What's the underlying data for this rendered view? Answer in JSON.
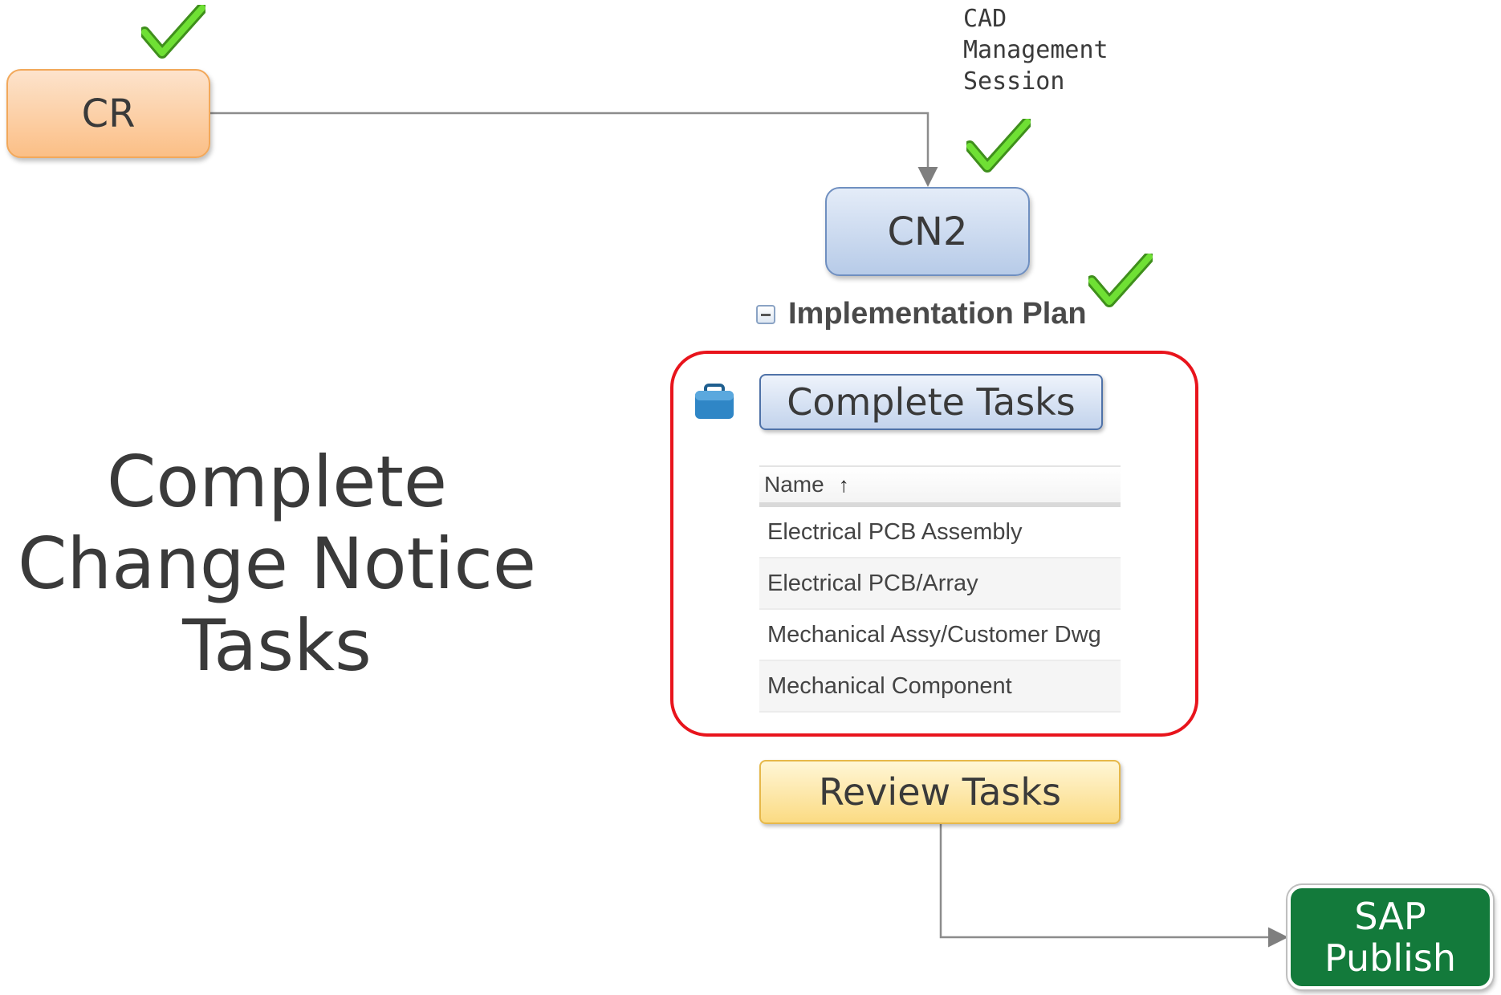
{
  "nodes": {
    "cr": "CR",
    "cn2": "CN2",
    "cad_session": "CAD\nManagement\nSession",
    "implementation_plan": "Implementation Plan",
    "complete_tasks": "Complete Tasks",
    "review_tasks": "Review Tasks",
    "sap_publish": "SAP\nPublish"
  },
  "task_table": {
    "header": "Name",
    "sort_indicator": "↑",
    "rows": [
      "Electrical PCB Assembly",
      "Electrical PCB/Array",
      "Mechanical Assy/Customer Dwg",
      "Mechanical Component"
    ]
  },
  "title": "Complete\nChange Notice\nTasks",
  "icons": [
    "check-icon",
    "check-icon",
    "check-icon",
    "briefcase-icon",
    "collapse-icon"
  ],
  "colors": {
    "cr": "#fbbf86",
    "cn2": "#b7cbe8",
    "review": "#fbdb83",
    "sap": "#137a3b",
    "highlight": "#e8141c",
    "check": "#5fd12c"
  }
}
